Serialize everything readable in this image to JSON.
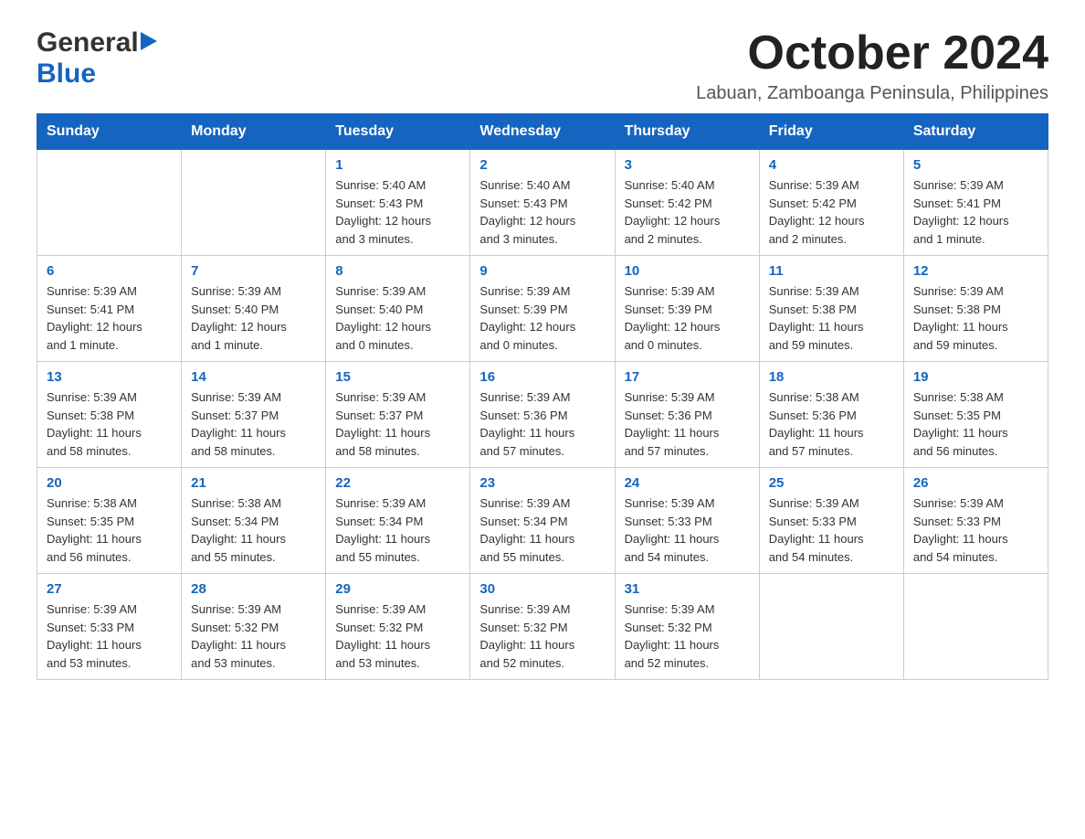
{
  "header": {
    "logo_general": "General",
    "logo_blue": "Blue",
    "month_title": "October 2024",
    "location": "Labuan, Zamboanga Peninsula, Philippines"
  },
  "weekdays": [
    "Sunday",
    "Monday",
    "Tuesday",
    "Wednesday",
    "Thursday",
    "Friday",
    "Saturday"
  ],
  "weeks": [
    [
      {
        "day": "",
        "info": ""
      },
      {
        "day": "",
        "info": ""
      },
      {
        "day": "1",
        "info": "Sunrise: 5:40 AM\nSunset: 5:43 PM\nDaylight: 12 hours\nand 3 minutes."
      },
      {
        "day": "2",
        "info": "Sunrise: 5:40 AM\nSunset: 5:43 PM\nDaylight: 12 hours\nand 3 minutes."
      },
      {
        "day": "3",
        "info": "Sunrise: 5:40 AM\nSunset: 5:42 PM\nDaylight: 12 hours\nand 2 minutes."
      },
      {
        "day": "4",
        "info": "Sunrise: 5:39 AM\nSunset: 5:42 PM\nDaylight: 12 hours\nand 2 minutes."
      },
      {
        "day": "5",
        "info": "Sunrise: 5:39 AM\nSunset: 5:41 PM\nDaylight: 12 hours\nand 1 minute."
      }
    ],
    [
      {
        "day": "6",
        "info": "Sunrise: 5:39 AM\nSunset: 5:41 PM\nDaylight: 12 hours\nand 1 minute."
      },
      {
        "day": "7",
        "info": "Sunrise: 5:39 AM\nSunset: 5:40 PM\nDaylight: 12 hours\nand 1 minute."
      },
      {
        "day": "8",
        "info": "Sunrise: 5:39 AM\nSunset: 5:40 PM\nDaylight: 12 hours\nand 0 minutes."
      },
      {
        "day": "9",
        "info": "Sunrise: 5:39 AM\nSunset: 5:39 PM\nDaylight: 12 hours\nand 0 minutes."
      },
      {
        "day": "10",
        "info": "Sunrise: 5:39 AM\nSunset: 5:39 PM\nDaylight: 12 hours\nand 0 minutes."
      },
      {
        "day": "11",
        "info": "Sunrise: 5:39 AM\nSunset: 5:38 PM\nDaylight: 11 hours\nand 59 minutes."
      },
      {
        "day": "12",
        "info": "Sunrise: 5:39 AM\nSunset: 5:38 PM\nDaylight: 11 hours\nand 59 minutes."
      }
    ],
    [
      {
        "day": "13",
        "info": "Sunrise: 5:39 AM\nSunset: 5:38 PM\nDaylight: 11 hours\nand 58 minutes."
      },
      {
        "day": "14",
        "info": "Sunrise: 5:39 AM\nSunset: 5:37 PM\nDaylight: 11 hours\nand 58 minutes."
      },
      {
        "day": "15",
        "info": "Sunrise: 5:39 AM\nSunset: 5:37 PM\nDaylight: 11 hours\nand 58 minutes."
      },
      {
        "day": "16",
        "info": "Sunrise: 5:39 AM\nSunset: 5:36 PM\nDaylight: 11 hours\nand 57 minutes."
      },
      {
        "day": "17",
        "info": "Sunrise: 5:39 AM\nSunset: 5:36 PM\nDaylight: 11 hours\nand 57 minutes."
      },
      {
        "day": "18",
        "info": "Sunrise: 5:38 AM\nSunset: 5:36 PM\nDaylight: 11 hours\nand 57 minutes."
      },
      {
        "day": "19",
        "info": "Sunrise: 5:38 AM\nSunset: 5:35 PM\nDaylight: 11 hours\nand 56 minutes."
      }
    ],
    [
      {
        "day": "20",
        "info": "Sunrise: 5:38 AM\nSunset: 5:35 PM\nDaylight: 11 hours\nand 56 minutes."
      },
      {
        "day": "21",
        "info": "Sunrise: 5:38 AM\nSunset: 5:34 PM\nDaylight: 11 hours\nand 55 minutes."
      },
      {
        "day": "22",
        "info": "Sunrise: 5:39 AM\nSunset: 5:34 PM\nDaylight: 11 hours\nand 55 minutes."
      },
      {
        "day": "23",
        "info": "Sunrise: 5:39 AM\nSunset: 5:34 PM\nDaylight: 11 hours\nand 55 minutes."
      },
      {
        "day": "24",
        "info": "Sunrise: 5:39 AM\nSunset: 5:33 PM\nDaylight: 11 hours\nand 54 minutes."
      },
      {
        "day": "25",
        "info": "Sunrise: 5:39 AM\nSunset: 5:33 PM\nDaylight: 11 hours\nand 54 minutes."
      },
      {
        "day": "26",
        "info": "Sunrise: 5:39 AM\nSunset: 5:33 PM\nDaylight: 11 hours\nand 54 minutes."
      }
    ],
    [
      {
        "day": "27",
        "info": "Sunrise: 5:39 AM\nSunset: 5:33 PM\nDaylight: 11 hours\nand 53 minutes."
      },
      {
        "day": "28",
        "info": "Sunrise: 5:39 AM\nSunset: 5:32 PM\nDaylight: 11 hours\nand 53 minutes."
      },
      {
        "day": "29",
        "info": "Sunrise: 5:39 AM\nSunset: 5:32 PM\nDaylight: 11 hours\nand 53 minutes."
      },
      {
        "day": "30",
        "info": "Sunrise: 5:39 AM\nSunset: 5:32 PM\nDaylight: 11 hours\nand 52 minutes."
      },
      {
        "day": "31",
        "info": "Sunrise: 5:39 AM\nSunset: 5:32 PM\nDaylight: 11 hours\nand 52 minutes."
      },
      {
        "day": "",
        "info": ""
      },
      {
        "day": "",
        "info": ""
      }
    ]
  ]
}
